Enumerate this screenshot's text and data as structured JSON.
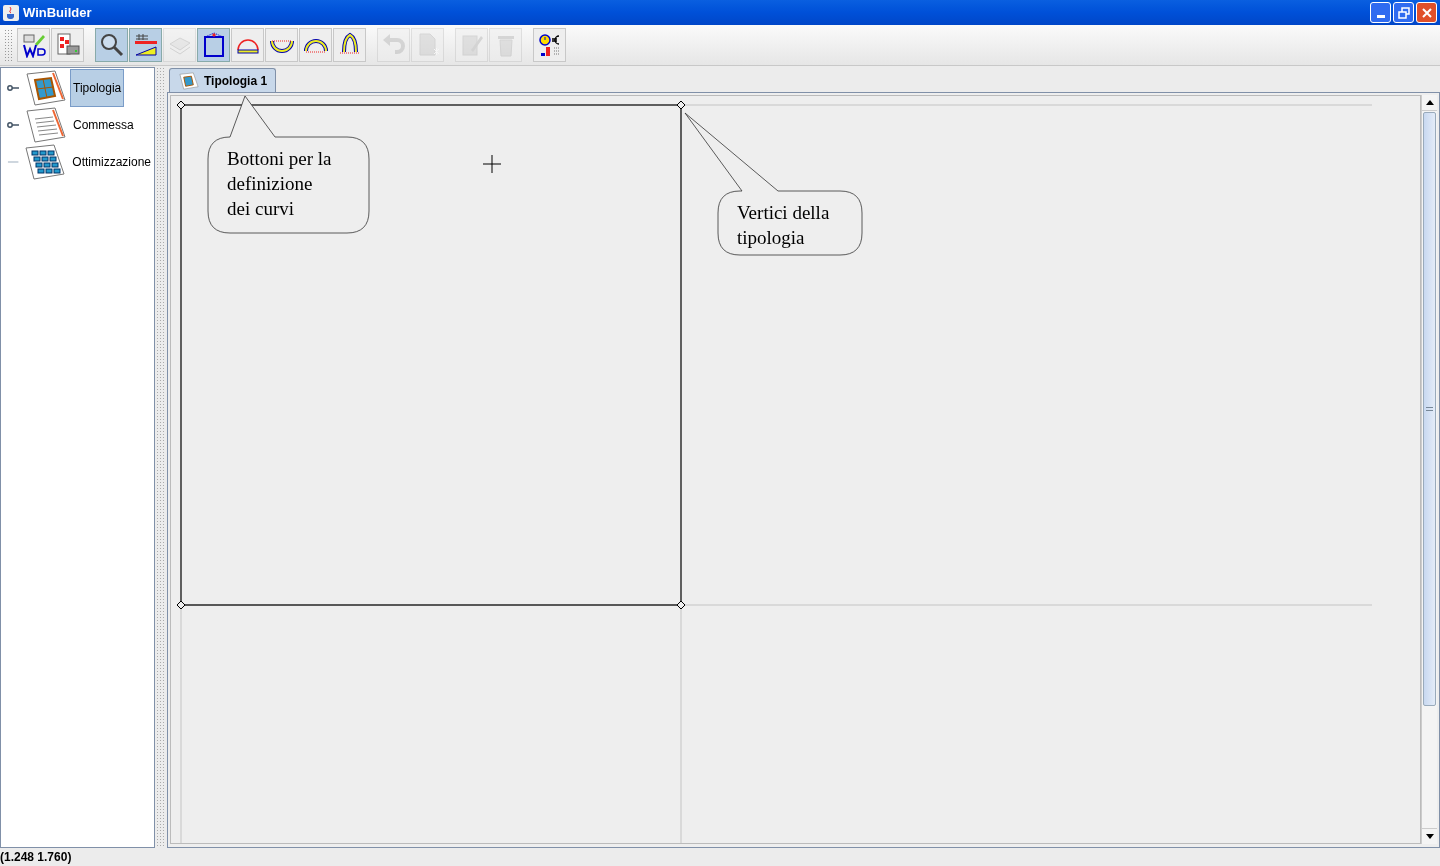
{
  "window": {
    "title": "WinBuilder"
  },
  "toolbar": {
    "groups": [
      [
        {
          "kind": "logo",
          "selected": false,
          "disabled": false
        },
        {
          "kind": "print",
          "selected": false,
          "disabled": false
        }
      ],
      [
        {
          "kind": "zoom",
          "selected": true,
          "disabled": false
        },
        {
          "kind": "ruler",
          "selected": true,
          "disabled": false
        },
        {
          "kind": "stack",
          "selected": false,
          "disabled": true
        },
        {
          "kind": "rect",
          "selected": true,
          "disabled": false
        },
        {
          "kind": "half",
          "selected": false,
          "disabled": false
        },
        {
          "kind": "bowl",
          "selected": false,
          "disabled": false
        },
        {
          "kind": "arch",
          "selected": false,
          "disabled": false
        },
        {
          "kind": "gothic",
          "selected": false,
          "disabled": false
        }
      ],
      [
        {
          "kind": "undo",
          "selected": false,
          "disabled": true
        },
        {
          "kind": "newdoc",
          "selected": false,
          "disabled": true
        }
      ],
      [
        {
          "kind": "edit",
          "selected": false,
          "disabled": true
        },
        {
          "kind": "trash",
          "selected": false,
          "disabled": true
        }
      ],
      [
        {
          "kind": "cost",
          "selected": false,
          "disabled": false
        }
      ]
    ]
  },
  "sidebar": {
    "items": [
      {
        "label": "Tipologia",
        "kind": "window",
        "selected": true,
        "expandable": true
      },
      {
        "label": "Commessa",
        "kind": "order",
        "selected": false,
        "expandable": true
      },
      {
        "label": "Ottimizzazione",
        "kind": "grid",
        "selected": false,
        "expandable": false
      }
    ]
  },
  "tabs": [
    {
      "label": "Tipologia 1",
      "selected": true
    }
  ],
  "callouts": [
    {
      "lines": [
        "Bottoni per la",
        "definizione",
        "dei curvi"
      ]
    },
    {
      "lines": [
        "Vertici della",
        "tipologia"
      ]
    }
  ],
  "status_bar": {
    "text": "(1.248 1.760)"
  }
}
